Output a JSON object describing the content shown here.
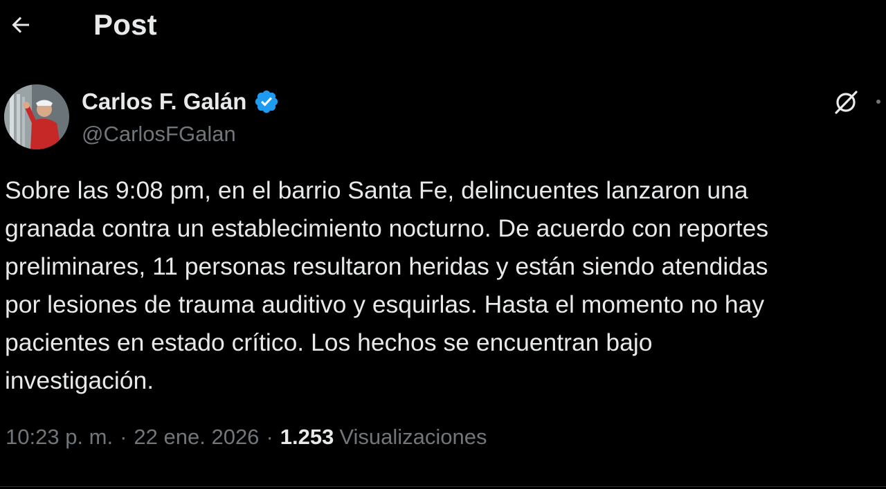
{
  "header": {
    "title": "Post",
    "back_icon": "arrow-left-icon"
  },
  "author": {
    "display_name": "Carlos F. Galán",
    "handle": "@CarlosFGalan",
    "verified_icon": "verified-badge-icon",
    "verified_color": "#1d9bf0"
  },
  "actions": {
    "grok_icon": "grok-icon",
    "more_icon": "more-icon"
  },
  "tweet": {
    "lines": [
      "Sobre las 9:08 pm, en el barrio Santa Fe, delincuentes lanzaron una",
      "granada contra un establecimiento nocturno. De acuerdo con reportes",
      "preliminares, 11 personas resultaron heridas y están siendo atendidas",
      "por lesiones de trauma auditivo y esquirlas. Hasta el momento no hay",
      "pacientes en estado crítico. Los hechos se encuentran bajo",
      "investigación."
    ]
  },
  "meta": {
    "time": "10:23 p. m.",
    "date": "22 ene. 2026",
    "separator": "·",
    "views_count": "1.253",
    "views_label": "Visualizaciones"
  },
  "colors": {
    "background": "#000000",
    "text_primary": "#e7e9ea",
    "text_secondary": "#71767b",
    "accent": "#1d9bf0"
  }
}
